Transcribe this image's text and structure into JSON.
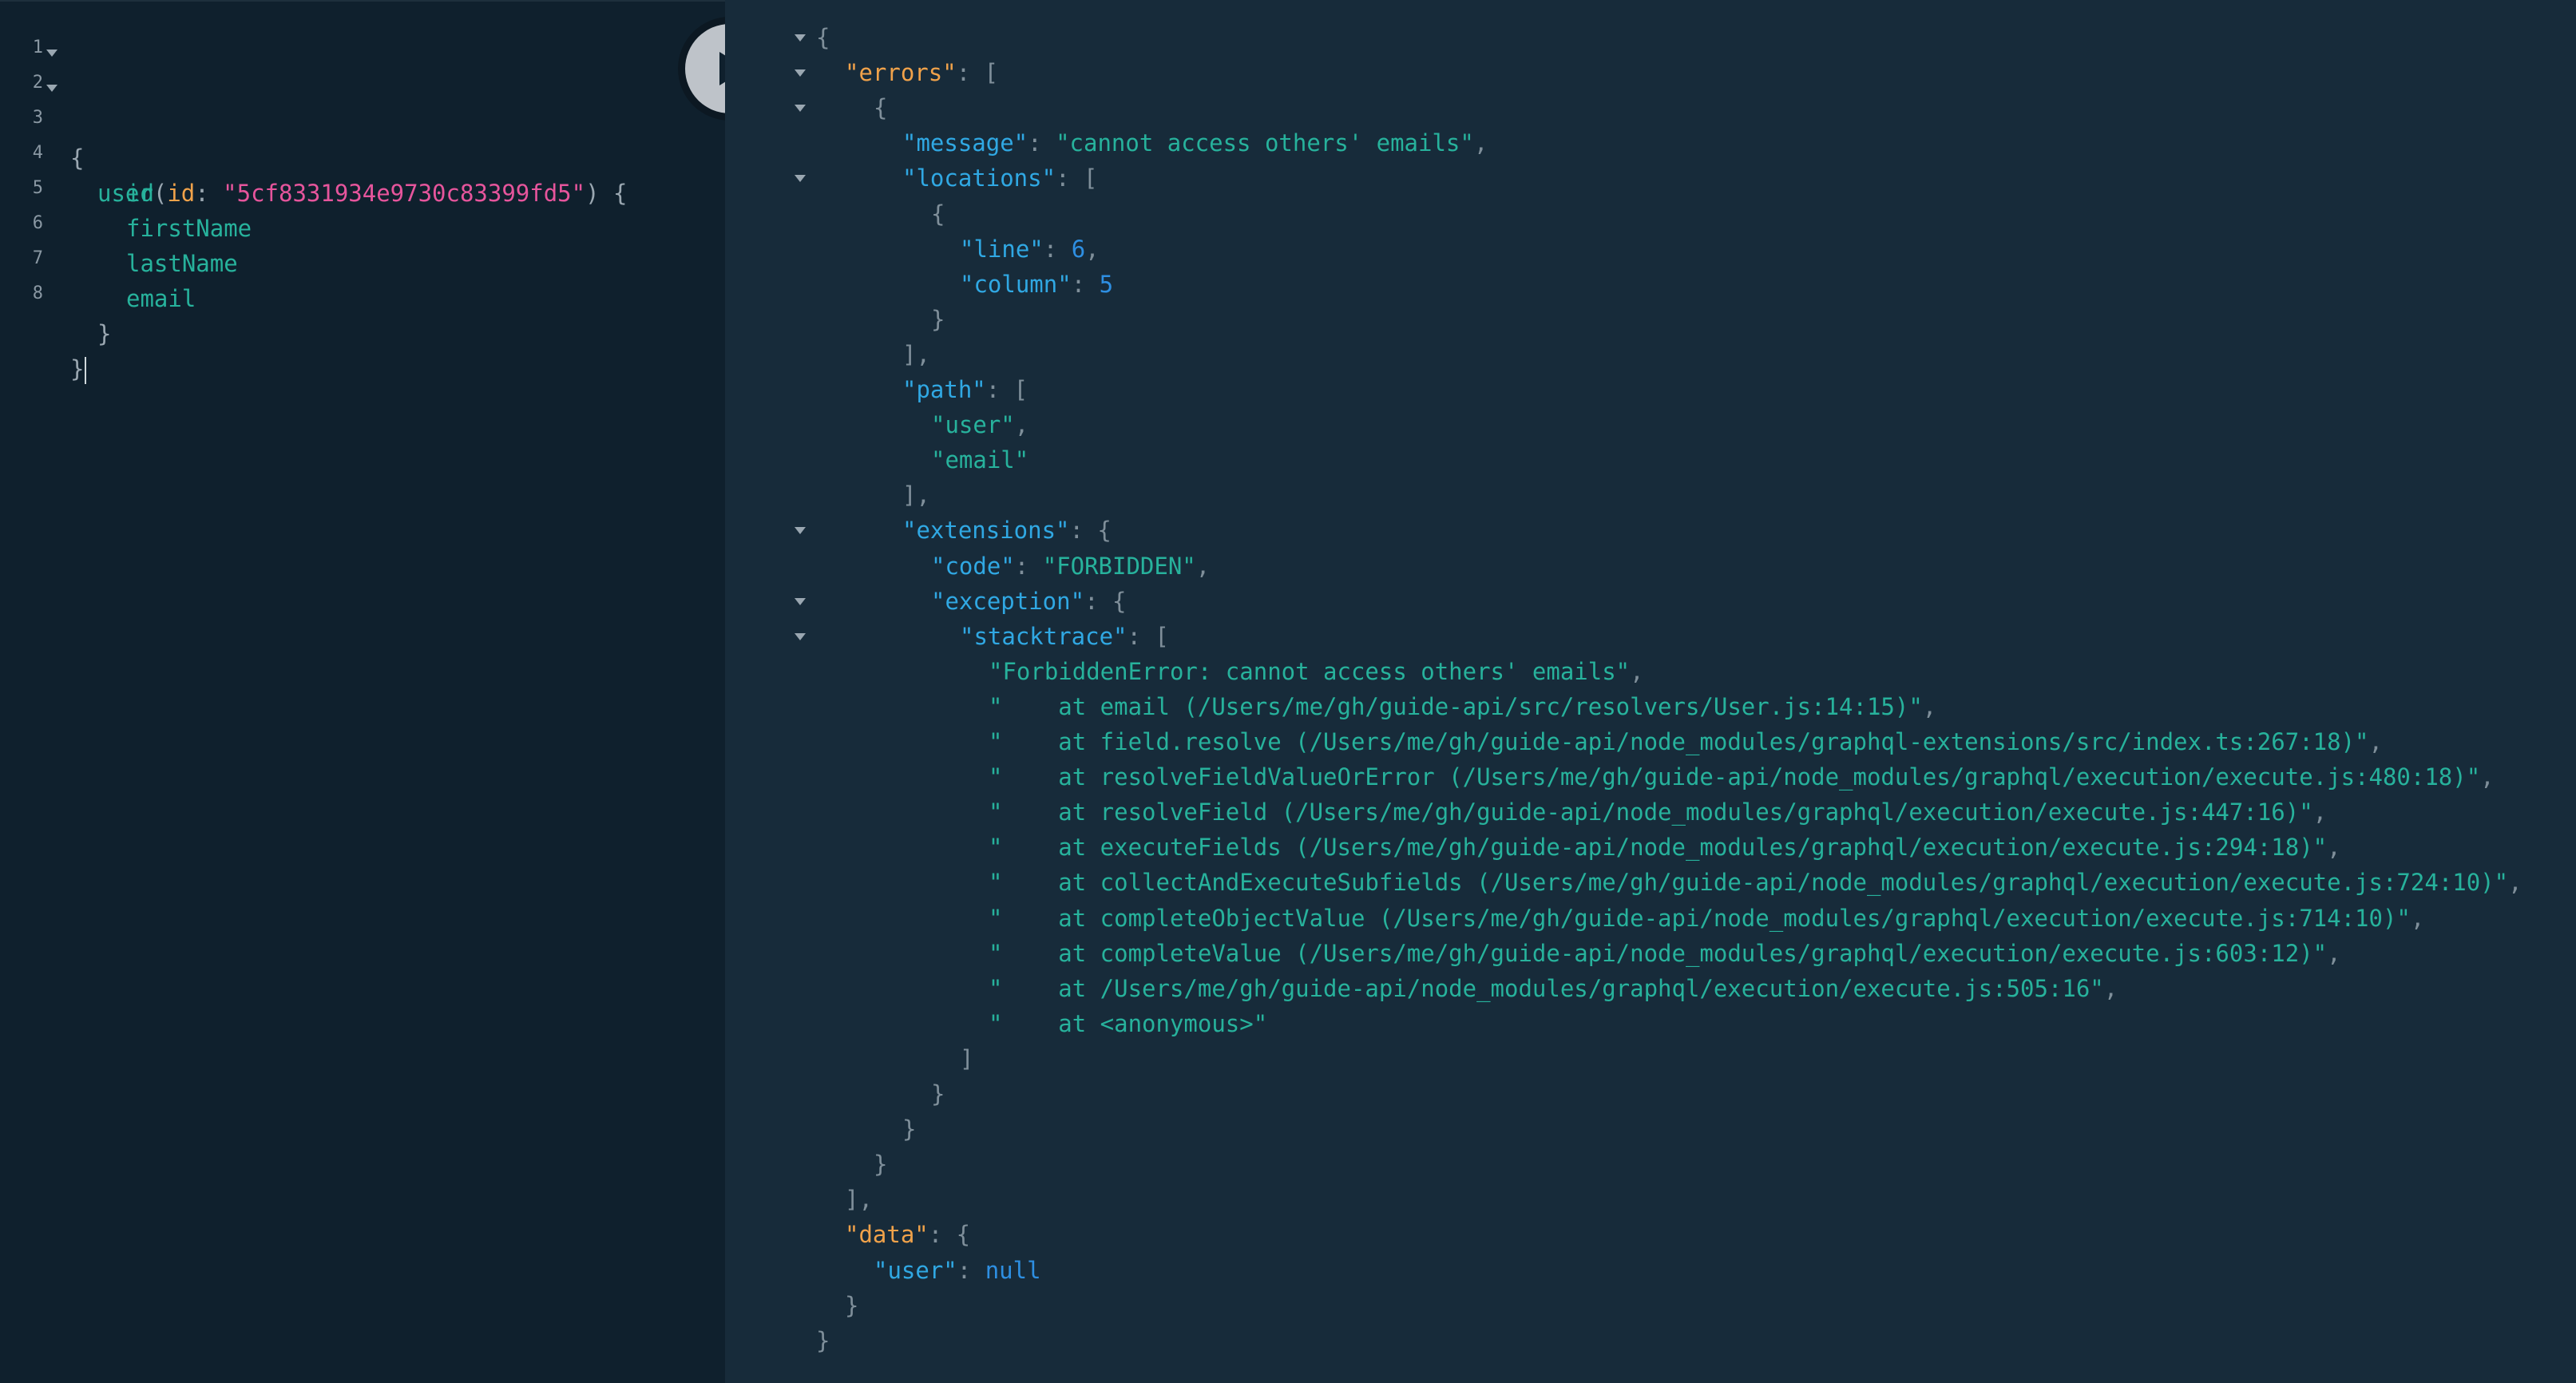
{
  "query": {
    "line_numbers": [
      "1",
      "2",
      "3",
      "4",
      "5",
      "6",
      "7",
      "8"
    ],
    "open_brace": "{",
    "close_brace": "}",
    "field_user": "user",
    "open_paren": "(",
    "arg_name": "id",
    "colon": ": ",
    "arg_value": "\"5cf8331934e9730c83399fd5\"",
    "close_paren_brace": ") {",
    "fields": [
      "id",
      "firstName",
      "lastName",
      "email"
    ],
    "inner_close": "}"
  },
  "run_button": {
    "icon": "play-icon",
    "label": "Execute Query"
  },
  "result": {
    "lines": [
      [
        {
          "t": "{",
          "c": "punct"
        }
      ],
      [
        {
          "t": "\"errors\"",
          "c": "k-orange"
        },
        {
          "t": ": [",
          "c": "punct"
        }
      ],
      [
        {
          "t": "{",
          "c": "punct"
        }
      ],
      [
        {
          "t": "\"message\"",
          "c": "k-blue"
        },
        {
          "t": ": ",
          "c": "punct"
        },
        {
          "t": "\"cannot access others' emails\"",
          "c": "s-green"
        },
        {
          "t": ",",
          "c": "punct"
        }
      ],
      [
        {
          "t": "\"locations\"",
          "c": "k-blue"
        },
        {
          "t": ": [",
          "c": "punct"
        }
      ],
      [
        {
          "t": "{",
          "c": "punct"
        }
      ],
      [
        {
          "t": "\"line\"",
          "c": "k-blue"
        },
        {
          "t": ": ",
          "c": "punct"
        },
        {
          "t": "6",
          "c": "n-blue"
        },
        {
          "t": ",",
          "c": "punct"
        }
      ],
      [
        {
          "t": "\"column\"",
          "c": "k-blue"
        },
        {
          "t": ": ",
          "c": "punct"
        },
        {
          "t": "5",
          "c": "n-blue"
        }
      ],
      [
        {
          "t": "}",
          "c": "punct"
        }
      ],
      [
        {
          "t": "],",
          "c": "punct"
        }
      ],
      [
        {
          "t": "\"path\"",
          "c": "k-blue"
        },
        {
          "t": ": [",
          "c": "punct"
        }
      ],
      [
        {
          "t": "\"user\"",
          "c": "s-green"
        },
        {
          "t": ",",
          "c": "punct"
        }
      ],
      [
        {
          "t": "\"email\"",
          "c": "s-green"
        }
      ],
      [
        {
          "t": "],",
          "c": "punct"
        }
      ],
      [
        {
          "t": "\"extensions\"",
          "c": "k-blue"
        },
        {
          "t": ": {",
          "c": "punct"
        }
      ],
      [
        {
          "t": "\"code\"",
          "c": "k-blue"
        },
        {
          "t": ": ",
          "c": "punct"
        },
        {
          "t": "\"FORBIDDEN\"",
          "c": "s-green"
        },
        {
          "t": ",",
          "c": "punct"
        }
      ],
      [
        {
          "t": "\"exception\"",
          "c": "k-blue"
        },
        {
          "t": ": {",
          "c": "punct"
        }
      ],
      [
        {
          "t": "\"stacktrace\"",
          "c": "k-blue"
        },
        {
          "t": ": [",
          "c": "punct"
        }
      ],
      [
        {
          "t": "\"ForbiddenError: cannot access others' emails\"",
          "c": "s-green"
        },
        {
          "t": ",",
          "c": "punct"
        }
      ],
      [
        {
          "t": "\"    at email (/Users/me/gh/guide-api/src/resolvers/User.js:14:15)\"",
          "c": "s-green"
        },
        {
          "t": ",",
          "c": "punct"
        }
      ],
      [
        {
          "t": "\"    at field.resolve (/Users/me/gh/guide-api/node_modules/graphql-extensions/src/index.ts:267:18)\"",
          "c": "s-green"
        },
        {
          "t": ",",
          "c": "punct"
        }
      ],
      [
        {
          "t": "\"    at resolveFieldValueOrError (/Users/me/gh/guide-api/node_modules/graphql/execution/execute.js:480:18)\"",
          "c": "s-green"
        },
        {
          "t": ",",
          "c": "punct"
        }
      ],
      [
        {
          "t": "\"    at resolveField (/Users/me/gh/guide-api/node_modules/graphql/execution/execute.js:447:16)\"",
          "c": "s-green"
        },
        {
          "t": ",",
          "c": "punct"
        }
      ],
      [
        {
          "t": "\"    at executeFields (/Users/me/gh/guide-api/node_modules/graphql/execution/execute.js:294:18)\"",
          "c": "s-green"
        },
        {
          "t": ",",
          "c": "punct"
        }
      ],
      [
        {
          "t": "\"    at collectAndExecuteSubfields (/Users/me/gh/guide-api/node_modules/graphql/execution/execute.js:724:10)\"",
          "c": "s-green"
        },
        {
          "t": ",",
          "c": "punct"
        }
      ],
      [
        {
          "t": "\"    at completeObjectValue (/Users/me/gh/guide-api/node_modules/graphql/execution/execute.js:714:10)\"",
          "c": "s-green"
        },
        {
          "t": ",",
          "c": "punct"
        }
      ],
      [
        {
          "t": "\"    at completeValue (/Users/me/gh/guide-api/node_modules/graphql/execution/execute.js:603:12)\"",
          "c": "s-green"
        },
        {
          "t": ",",
          "c": "punct"
        }
      ],
      [
        {
          "t": "\"    at /Users/me/gh/guide-api/node_modules/graphql/execution/execute.js:505:16\"",
          "c": "s-green"
        },
        {
          "t": ",",
          "c": "punct"
        }
      ],
      [
        {
          "t": "\"    at <anonymous>\"",
          "c": "s-green"
        }
      ],
      [
        {
          "t": "]",
          "c": "punct"
        }
      ],
      [
        {
          "t": "}",
          "c": "punct"
        }
      ],
      [
        {
          "t": "}",
          "c": "punct"
        }
      ],
      [
        {
          "t": "}",
          "c": "punct"
        }
      ],
      [
        {
          "t": "],",
          "c": "punct"
        }
      ],
      [
        {
          "t": "\"data\"",
          "c": "k-orange"
        },
        {
          "t": ": {",
          "c": "punct"
        }
      ],
      [
        {
          "t": "\"user\"",
          "c": "k-blue"
        },
        {
          "t": ": ",
          "c": "punct"
        },
        {
          "t": "null",
          "c": "n-blue"
        }
      ],
      [
        {
          "t": "}",
          "c": "punct"
        }
      ],
      [
        {
          "t": "}",
          "c": "punct"
        }
      ]
    ]
  }
}
